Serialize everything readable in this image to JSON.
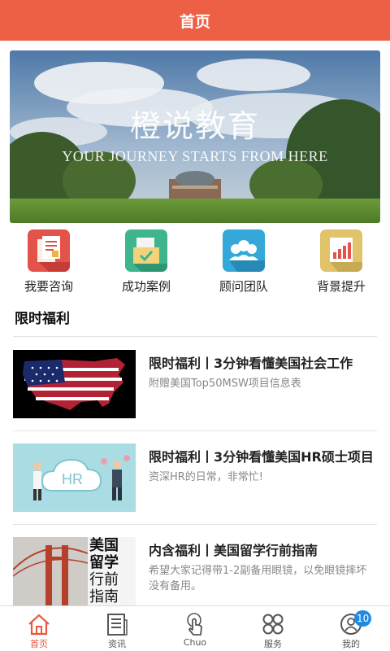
{
  "header": {
    "title": "首页"
  },
  "banner": {
    "title": "橙说教育",
    "subtitle": "YOUR JOURNEY STARTS FROM HERE"
  },
  "quick_links": [
    {
      "label": "我要咨询",
      "icon": "consult-document-icon",
      "color": "#e4534a"
    },
    {
      "label": "成功案例",
      "icon": "success-case-icon",
      "color": "#3eb58c"
    },
    {
      "label": "顾问团队",
      "icon": "team-people-icon",
      "color": "#34a8d8"
    },
    {
      "label": "背景提升",
      "icon": "chart-boost-icon",
      "color": "#e0c36b"
    }
  ],
  "section": {
    "title": "限时福利"
  },
  "news": [
    {
      "title": "限时福利丨3分钟看懂美国社会工作",
      "desc": "附赠美国Top50MSW项目信息表",
      "thumb": "usa-flag-map"
    },
    {
      "title": "限时福利丨3分钟看懂美国HR硕士项目",
      "desc": "资深HR的日常，非常忙!",
      "thumb": "hr-cloud-illustration",
      "thumb_text": "HR"
    },
    {
      "title": "内含福利丨美国留学行前指南",
      "desc": "希望大家记得带1-2副备用眼镜，以免眼镜摔坏没有备用。",
      "thumb": "golden-gate-guide",
      "thumb_text": [
        "美国",
        "留学",
        "行前",
        "指南"
      ]
    }
  ],
  "tabbar": {
    "items": [
      {
        "label": "首页",
        "icon": "home-icon",
        "active": true
      },
      {
        "label": "资讯",
        "icon": "news-icon"
      },
      {
        "label": "Chuo",
        "icon": "touch-hand-icon"
      },
      {
        "label": "服务",
        "icon": "services-grid-icon"
      },
      {
        "label": "我的",
        "icon": "profile-icon",
        "badge": "10"
      }
    ]
  },
  "colors": {
    "brand": "#ee6045",
    "active_tab": "#e8573c",
    "badge": "#1f8ae6"
  }
}
